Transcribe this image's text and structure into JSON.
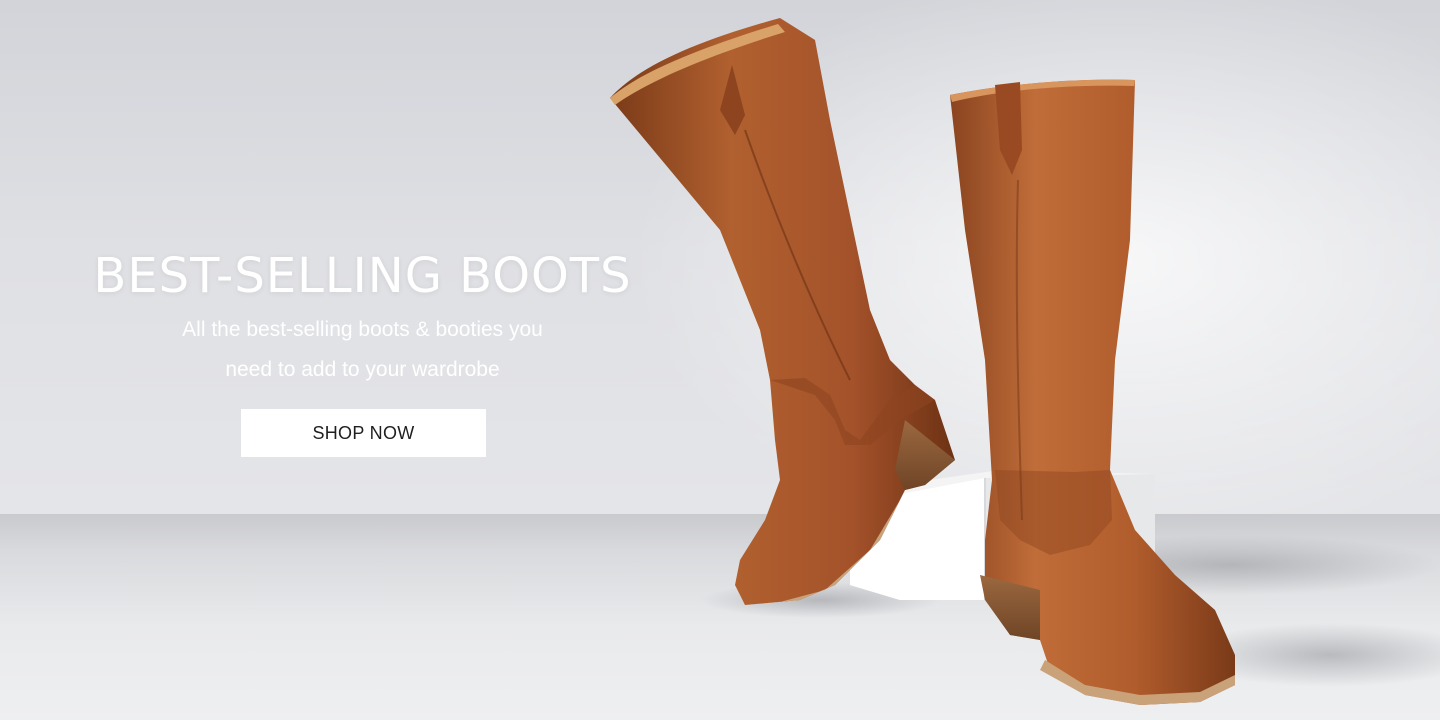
{
  "hero": {
    "headline": "BEST-SELLING BOOTS",
    "subline_1": "All the best-selling boots & booties you",
    "subline_2": "need to add to your wardrobe",
    "cta_label": "SHOP NOW"
  },
  "colors": {
    "boot_leather": "#a8552a",
    "boot_leather_dark": "#7a3a18",
    "heel_wood": "#8a5a36",
    "pedestal": "#f3f3f4",
    "button_bg": "#ffffff",
    "text": "#ffffff"
  },
  "image": {
    "subject": "pair of tall cognac leather boots on white pedestal"
  }
}
